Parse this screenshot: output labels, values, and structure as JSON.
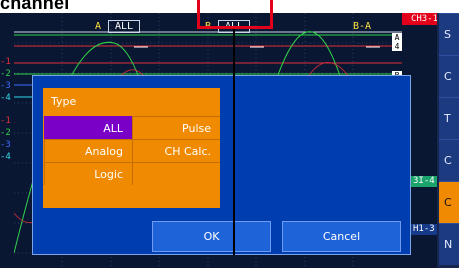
{
  "heading": "channel",
  "channel_tab": "CH3-1",
  "cursor_a": {
    "letter": "A",
    "value": "ALL"
  },
  "cursor_b": {
    "letter": "B",
    "value": "ALL"
  },
  "cursor_diff": "B-A",
  "channel_labels": [
    "-1",
    "-2",
    "-3",
    "-4",
    "-1",
    "-2",
    "-3",
    "-4"
  ],
  "markers": [
    "A 4",
    "B 4"
  ],
  "side_tags": [
    "3I-4",
    "H1-3"
  ],
  "sidebar_buttons": [
    "S",
    "C",
    "T",
    "C",
    "C",
    "N"
  ],
  "dialog": {
    "header": "Type",
    "options": [
      "ALL",
      "Pulse",
      "Analog",
      "CH Calc.",
      "Logic"
    ],
    "selected": "ALL",
    "ok": "OK",
    "cancel": "Cancel"
  }
}
